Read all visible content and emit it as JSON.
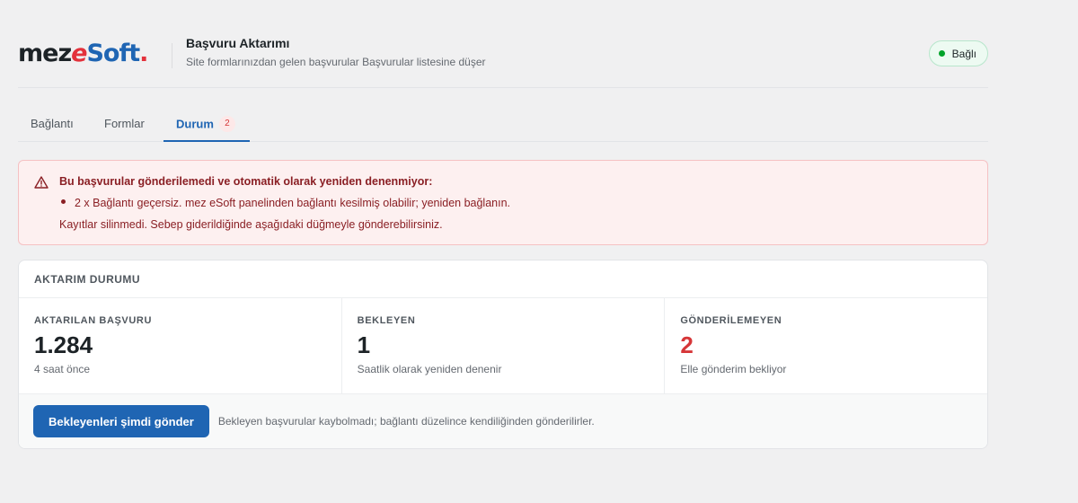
{
  "header": {
    "logo": {
      "part1": "mez",
      "part2": "e",
      "part3": "Soft",
      "part4": "."
    },
    "title": "Başvuru Aktarımı",
    "subtitle": "Site formlarınızdan gelen başvurular Başvurular listesine düşer",
    "status": {
      "label": "Bağlı",
      "color": "#00a32a"
    }
  },
  "tabs": [
    {
      "label": "Bağlantı"
    },
    {
      "label": "Formlar"
    },
    {
      "label": "Durum",
      "badge": "2",
      "active": true
    }
  ],
  "alert": {
    "icon": "warning-icon",
    "title": "Bu başvurular gönderilemedi ve otomatik olarak yeniden denenmiyor:",
    "items": [
      "2 x Bağlantı geçersiz. mez eSoft panelinden bağlantı kesilmiş olabilir; yeniden bağlanın."
    ],
    "note": "Kayıtlar silinmedi. Sebep giderildiğinde aşağıdaki düğmeyle gönderebilirsiniz."
  },
  "card": {
    "title": "AKTARIM DURUMU",
    "stats": [
      {
        "label": "AKTARILAN BAŞVURU",
        "value": "1.284",
        "sub": "4 saat önce"
      },
      {
        "label": "BEKLEYEN",
        "value": "1",
        "sub": "Saatlik olarak yeniden denenir"
      },
      {
        "label": "GÖNDERİLEMEYEN",
        "value": "2",
        "sub": "Elle gönderim bekliyor"
      }
    ],
    "button_label": "Bekleyenleri şimdi gönder",
    "footer_note": "Bekleyen başvurular kaybolmadı; bağlantı düzelince kendiliğinden gönderilirler."
  },
  "colors": {
    "accent": "#1f65b3",
    "danger": "#d63638",
    "success": "#00a32a"
  }
}
